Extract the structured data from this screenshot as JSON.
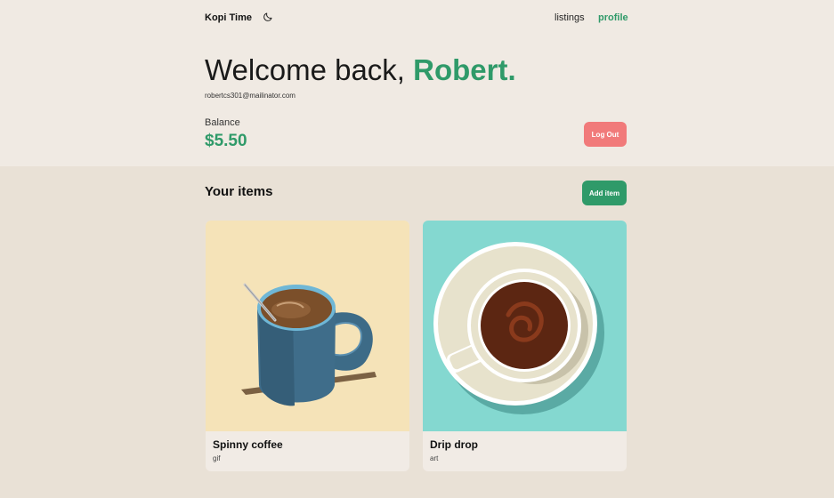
{
  "header": {
    "brand": "Kopi Time",
    "theme_icon": "moon-icon",
    "nav": {
      "listings": "listings",
      "profile": "profile"
    }
  },
  "profile": {
    "greeting": "Welcome back,",
    "name": "Robert.",
    "email": "robertcs301@mailinator.com",
    "balance_label": "Balance",
    "balance_value": "$5.50",
    "logout_label": "Log Out"
  },
  "items_section": {
    "title": "Your items",
    "add_label": "Add item",
    "items": [
      {
        "title": "Spinny coffee",
        "type": "gif",
        "image": "blue-coffee-mug-illustration",
        "bg": "#f5e3b8"
      },
      {
        "title": "Drip drop",
        "type": "art",
        "image": "coffee-cup-top-view-illustration",
        "bg": "#84d8d0"
      }
    ]
  },
  "colors": {
    "accent": "#2f9a69",
    "logout": "#f17a7a",
    "page_bg": "#e9e1d6",
    "header_bg": "#f0eae3"
  }
}
